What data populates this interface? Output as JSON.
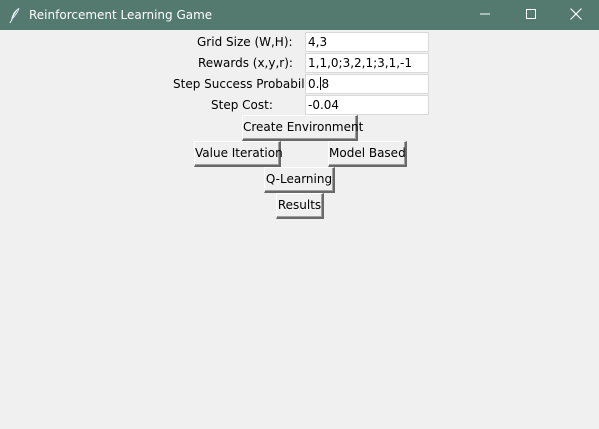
{
  "window": {
    "title": "Reinforcement Learning Game",
    "titlebar_color": "#547a6f",
    "icon": "feather-icon",
    "controls": {
      "minimize_icon": "minimize-icon",
      "maximize_icon": "maximize-icon",
      "close_icon": "close-icon"
    }
  },
  "form": {
    "grid_size": {
      "label": "Grid Size (W,H):",
      "value": "4,3"
    },
    "rewards": {
      "label": "Rewards (x,y,r):",
      "value": "1,1,0;3,2,1;3,1,-1"
    },
    "step_success": {
      "label": "Step Success Probability:",
      "value_before_caret": "0.",
      "value_after_caret": "8"
    },
    "step_cost": {
      "label": "Step Cost:",
      "value": "-0.04"
    }
  },
  "buttons": {
    "create_environment": "Create Environment",
    "value_iteration": "Value Iteration",
    "model_based": "Model Based",
    "q_learning": "Q-Learning",
    "results": "Results"
  }
}
